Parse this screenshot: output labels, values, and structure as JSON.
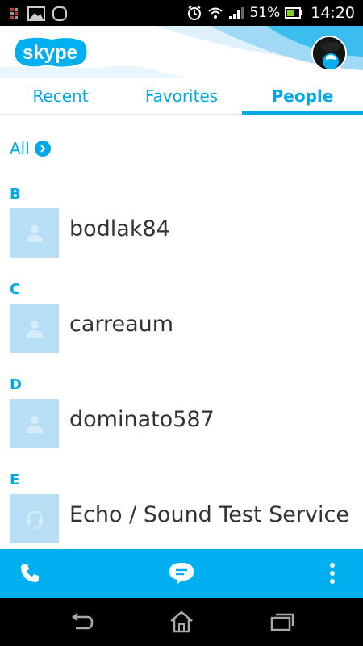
{
  "status_bar": {
    "battery_percent": "51%",
    "time": "14:20",
    "icons": [
      "sim-icon",
      "gallery-icon",
      "notification-icon",
      "alarm-icon",
      "wifi-icon",
      "signal-icon",
      "battery-icon"
    ]
  },
  "header": {
    "logo_text": "skype",
    "profile": "profile-avatar"
  },
  "tabs": [
    {
      "label": "Recent",
      "active": false
    },
    {
      "label": "Favorites",
      "active": false
    },
    {
      "label": "People",
      "active": true
    }
  ],
  "filter": {
    "label": "All"
  },
  "sections": [
    {
      "letter": "B",
      "contacts": [
        {
          "name": "bodlak84",
          "icon": "person-icon"
        }
      ]
    },
    {
      "letter": "C",
      "contacts": [
        {
          "name": "carreaum",
          "icon": "person-icon"
        }
      ]
    },
    {
      "letter": "D",
      "contacts": [
        {
          "name": "dominato587",
          "icon": "person-icon"
        }
      ]
    },
    {
      "letter": "E",
      "contacts": [
        {
          "name": "Echo / Sound Test Service",
          "icon": "headset-icon"
        }
      ]
    }
  ],
  "action_bar": {
    "buttons": [
      "phone-icon",
      "chat-icon",
      "more-icon"
    ]
  },
  "nav_bar": {
    "buttons": [
      "back-icon",
      "home-icon",
      "recent-apps-icon"
    ]
  },
  "colors": {
    "accent": "#00aff0",
    "text": "#333333",
    "avatar_bg": "#b8def5"
  }
}
